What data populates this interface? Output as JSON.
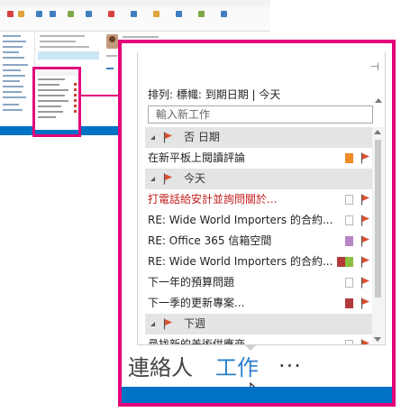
{
  "colors": {
    "callout_border": "#e3007b",
    "accent_blue": "#0072c6",
    "tasks_blue": "#2b7fc9",
    "flag_red": "#d9502f",
    "urgent_text": "#c41e1e",
    "group_bg": "#e4e4e4"
  },
  "task_pane": {
    "sort_label": "排列: 標幟: 到期日期 | 今天",
    "new_task_placeholder": "輸入新工作",
    "pin_icon": "⊣"
  },
  "groups": [
    {
      "label": "否 日期",
      "tasks": [
        {
          "label": "在新平板上閱讀評論",
          "category_colors": [
            "#f08a24"
          ],
          "urgent": false
        }
      ]
    },
    {
      "label": "今天",
      "tasks": [
        {
          "label": "打電話給安計並詢問關於...",
          "category_colors": [],
          "urgent": true
        },
        {
          "label": "RE: Wide World Importers 的合約...",
          "category_colors": [],
          "urgent": false
        },
        {
          "label": "RE: Office 365 信箱空間",
          "category_colors": [
            "#b784c4"
          ],
          "urgent": false
        },
        {
          "label": "RE: Wide World Importers 的合約...",
          "category_colors": [
            "#b23a3a",
            "#8cbf3f"
          ],
          "urgent": false
        },
        {
          "label": "下一年的預算問題",
          "category_colors": [],
          "urgent": false
        },
        {
          "label": "下一季的更新專案...",
          "category_colors": [
            "#b23a3a"
          ],
          "urgent": false
        }
      ]
    },
    {
      "label": "下週",
      "tasks": [
        {
          "label": "尋找新的美術供應商",
          "category_colors": [],
          "urgent": false
        }
      ]
    }
  ],
  "nav": {
    "contacts_label": "連絡人",
    "tasks_label": "工作",
    "more_label": "···"
  }
}
